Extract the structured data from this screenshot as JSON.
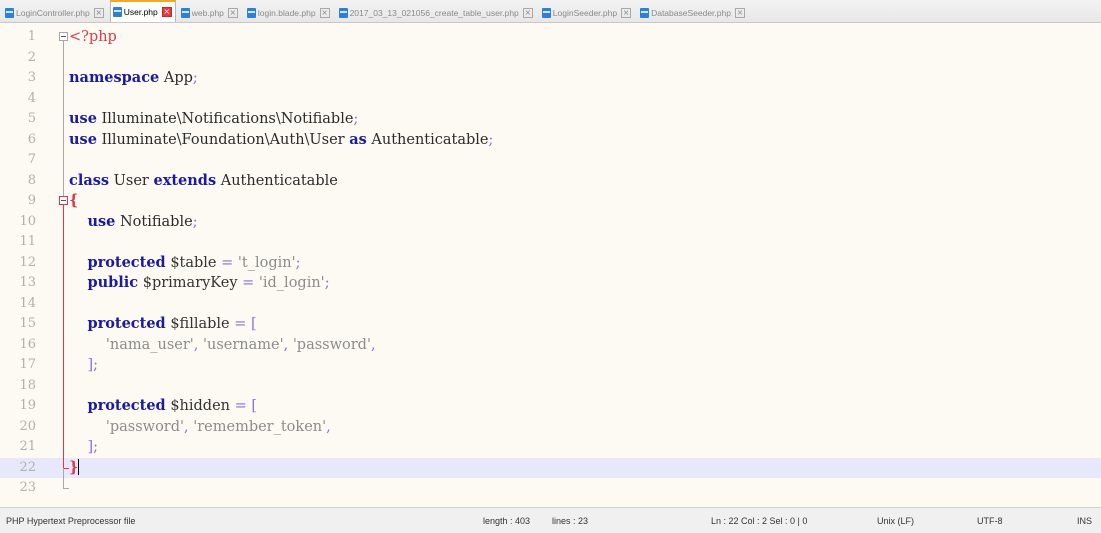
{
  "tabs": [
    {
      "label": "LoginController.php",
      "active": false
    },
    {
      "label": "User.php",
      "active": true
    },
    {
      "label": "web.php",
      "active": false
    },
    {
      "label": "login.blade.php",
      "active": false
    },
    {
      "label": "2017_03_13_021056_create_table_user.php",
      "active": false
    },
    {
      "label": "LoginSeeder.php",
      "active": false
    },
    {
      "label": "DatabaseSeeder.php",
      "active": false
    }
  ],
  "close_glyph": "×",
  "editor": {
    "current_line": 22,
    "lines": [
      {
        "n": "1",
        "t": "<?php"
      },
      {
        "n": "2",
        "t": ""
      },
      {
        "n": "3",
        "t": "namespace App;"
      },
      {
        "n": "4",
        "t": ""
      },
      {
        "n": "5",
        "t": "use Illuminate\\Notifications\\Notifiable;"
      },
      {
        "n": "6",
        "t": "use Illuminate\\Foundation\\Auth\\User as Authenticatable;"
      },
      {
        "n": "7",
        "t": ""
      },
      {
        "n": "8",
        "t": "class User extends Authenticatable"
      },
      {
        "n": "9",
        "t": "{"
      },
      {
        "n": "10",
        "t": "    use Notifiable;"
      },
      {
        "n": "11",
        "t": ""
      },
      {
        "n": "12",
        "t": "    protected $table = 't_login';"
      },
      {
        "n": "13",
        "t": "    public $primaryKey = 'id_login';"
      },
      {
        "n": "14",
        "t": ""
      },
      {
        "n": "15",
        "t": "    protected $fillable = ["
      },
      {
        "n": "16",
        "t": "        'nama_user', 'username', 'password',"
      },
      {
        "n": "17",
        "t": "    ];"
      },
      {
        "n": "18",
        "t": ""
      },
      {
        "n": "19",
        "t": "    protected $hidden = ["
      },
      {
        "n": "20",
        "t": "        'password', 'remember_token',"
      },
      {
        "n": "21",
        "t": "    ];"
      },
      {
        "n": "22",
        "t": "}"
      },
      {
        "n": "23",
        "t": ""
      }
    ]
  },
  "status": {
    "filetype": "PHP Hypertext Preprocessor file",
    "length": "length : 403",
    "lines": "lines : 23",
    "position": "Ln : 22   Col : 2   Sel : 0 | 0",
    "eol": "Unix (LF)",
    "encoding": "UTF-8",
    "mode": "INS"
  },
  "colors": {
    "keyword": "#1a1aa6",
    "string": "#8c8c8c",
    "php_tag": "#e0384a",
    "editor_bg": "#fdfaf3",
    "current_line_bg": "#e8e8fb",
    "active_tab_accent": "#f5a623"
  }
}
